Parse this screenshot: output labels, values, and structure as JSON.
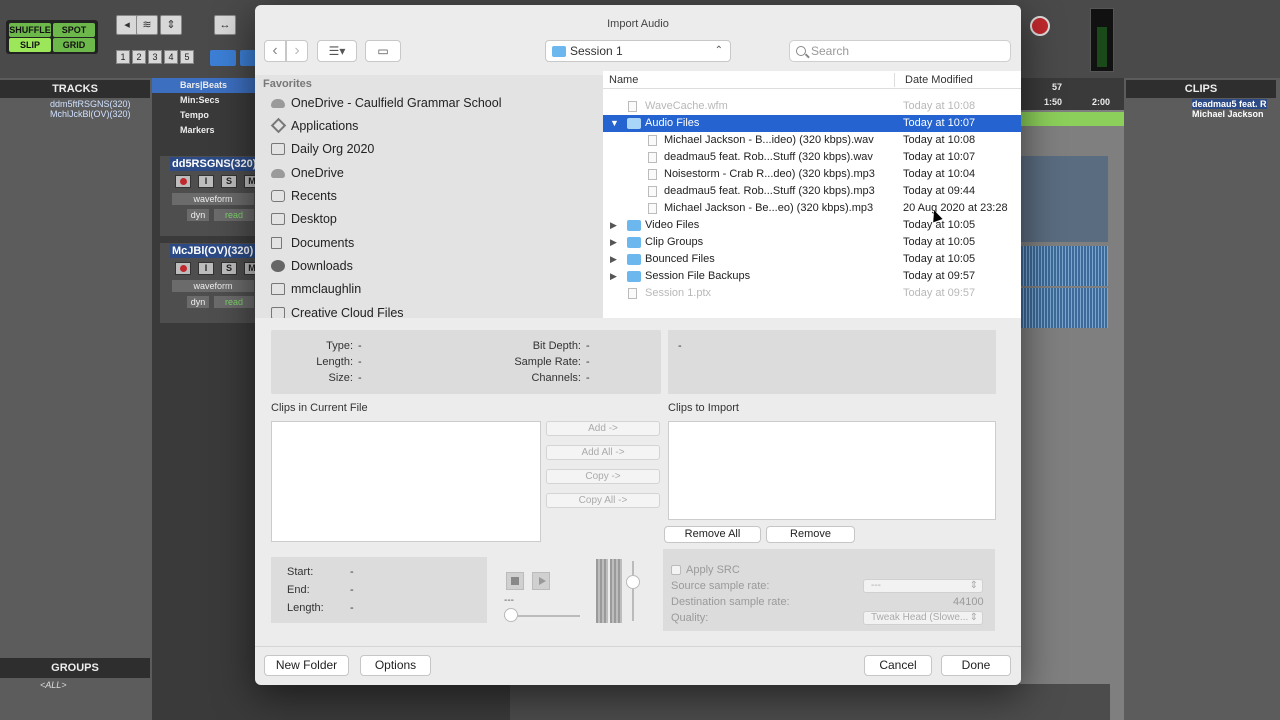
{
  "daw": {
    "modes": [
      "SHUFFLE",
      "SPOT",
      "SLIP",
      "GRID"
    ],
    "nudge_numbers": [
      "1",
      "2",
      "3",
      "4",
      "5"
    ],
    "tracks_header": "TRACKS",
    "track_list": [
      "ddm5ftRSGNS(320)",
      "MchlJckBl(OV)(320)"
    ],
    "rulers": [
      "Bars|Beats",
      "Min:Secs",
      "Tempo",
      "Markers"
    ],
    "tracks": [
      {
        "name": "dd5RSGNS(320)",
        "view": "waveform",
        "auto_label": "dyn",
        "mode": "read"
      },
      {
        "name": "McJBl(OV)(320)",
        "view": "waveform",
        "auto_label": "dyn",
        "mode": "read"
      }
    ],
    "track_buttons": [
      "S",
      "I",
      "M"
    ],
    "groups_header": "GROUPS",
    "groups_item": "<ALL>",
    "clips_header": "CLIPS",
    "clips": [
      "deadmau5 feat. R",
      "Michael Jackson"
    ],
    "timeline_markers": [
      "57",
      "1:50",
      "2:00"
    ]
  },
  "dialog": {
    "title": "Import Audio",
    "location": "Session 1",
    "search_placeholder": "Search",
    "sidebar": {
      "heading": "Favorites",
      "items": [
        {
          "label": "OneDrive - Caulfield Grammar School",
          "icon": "cloud-icon"
        },
        {
          "label": "Applications",
          "icon": "applications-icon"
        },
        {
          "label": "Daily Org 2020",
          "icon": "folder-icon"
        },
        {
          "label": "OneDrive",
          "icon": "cloud-icon"
        },
        {
          "label": "Recents",
          "icon": "recents-icon"
        },
        {
          "label": "Desktop",
          "icon": "desktop-icon"
        },
        {
          "label": "Documents",
          "icon": "documents-icon"
        },
        {
          "label": "Downloads",
          "icon": "downloads-icon"
        },
        {
          "label": "mmclaughlin",
          "icon": "home-icon"
        },
        {
          "label": "Creative Cloud Files",
          "icon": "folder-icon"
        }
      ]
    },
    "columns": {
      "name": "Name",
      "date": "Date Modified"
    },
    "files": [
      {
        "name": "WaveCache.wfm",
        "date": "Today at 10:08",
        "kind": "file",
        "dim": true
      },
      {
        "name": "Audio Files",
        "date": "Today at 10:07",
        "kind": "folder",
        "expanded": true,
        "selected": true
      },
      {
        "name": "Michael Jackson - B...ideo) (320  kbps).wav",
        "date": "Today at 10:08",
        "kind": "child"
      },
      {
        "name": "deadmau5 feat. Rob...Stuff (320  kbps).wav",
        "date": "Today at 10:07",
        "kind": "child"
      },
      {
        "name": "Noisestorm - Crab R...deo) (320  kbps).mp3",
        "date": "Today at 10:04",
        "kind": "child"
      },
      {
        "name": "deadmau5 feat. Rob...Stuff (320  kbps).mp3",
        "date": "Today at 09:44",
        "kind": "child"
      },
      {
        "name": "Michael Jackson - Be...eo) (320  kbps).mp3",
        "date": "20 Aug 2020 at 23:28",
        "kind": "child"
      },
      {
        "name": "Video Files",
        "date": "Today at 10:05",
        "kind": "folder"
      },
      {
        "name": "Clip Groups",
        "date": "Today at 10:05",
        "kind": "folder"
      },
      {
        "name": "Bounced Files",
        "date": "Today at 10:05",
        "kind": "folder"
      },
      {
        "name": "Session File Backups",
        "date": "Today at 09:57",
        "kind": "folder"
      },
      {
        "name": "Session 1.ptx",
        "date": "Today at 09:57",
        "kind": "file",
        "dim": true
      }
    ],
    "info": {
      "type_label": "Type:",
      "type_value": "-",
      "length_label": "Length:",
      "length_value": "-",
      "size_label": "Size:",
      "size_value": "-",
      "bitdepth_label": "Bit Depth:",
      "bitdepth_value": "-",
      "samplerate_label": "Sample Rate:",
      "samplerate_value": "-",
      "channels_label": "Channels:",
      "channels_value": "-",
      "comment_value": "-"
    },
    "clips_in_file_label": "Clips in Current File",
    "clips_to_import_label": "Clips to Import",
    "add_btn": "Add ->",
    "add_all_btn": "Add All ->",
    "copy_btn": "Copy ->",
    "copy_all_btn": "Copy All ->",
    "remove_all_btn": "Remove All",
    "remove_btn": "Remove",
    "preview": {
      "start_label": "Start:",
      "start_value": "-",
      "end_label": "End:",
      "end_value": "-",
      "length_label": "Length:",
      "length_value": "-",
      "volume_readout": "---"
    },
    "src": {
      "apply_label": "Apply SRC",
      "source_label": "Source sample rate:",
      "source_value": "---",
      "dest_label": "Destination sample rate:",
      "dest_value": "44100",
      "quality_label": "Quality:",
      "quality_value": "Tweak Head (Slowe..."
    },
    "new_folder_btn": "New Folder",
    "options_btn": "Options",
    "cancel_btn": "Cancel",
    "done_btn": "Done"
  }
}
